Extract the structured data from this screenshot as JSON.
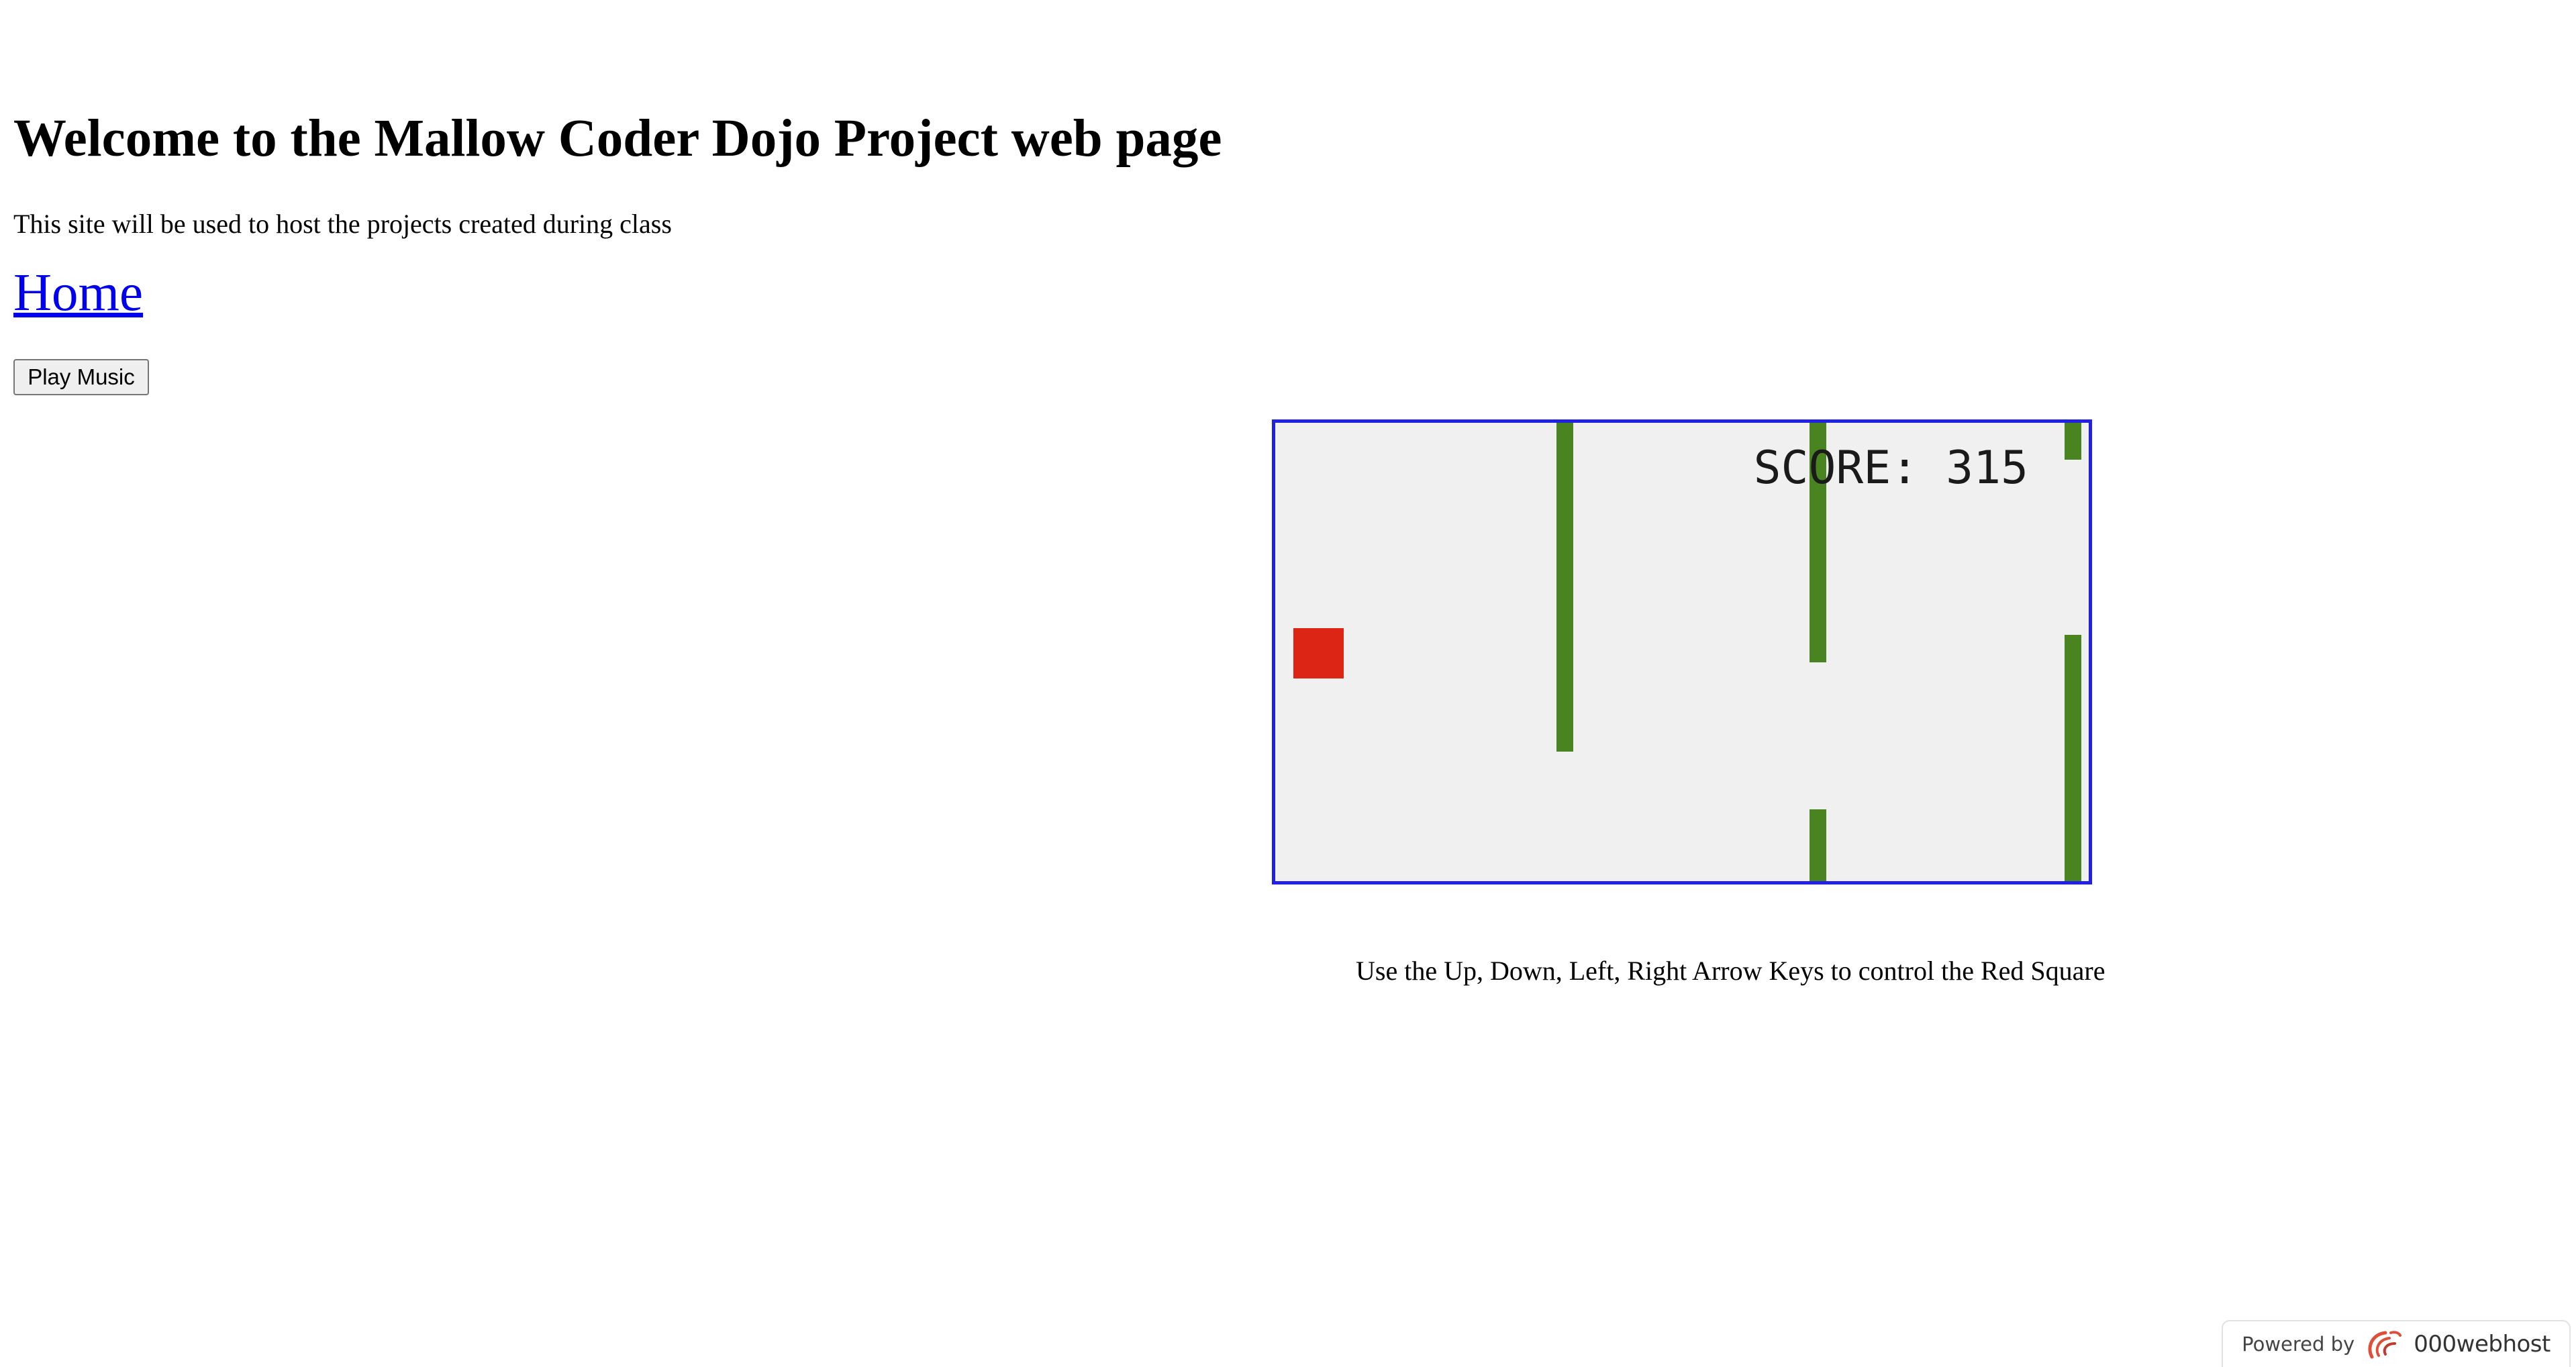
{
  "page": {
    "title": "Welcome to the Mallow Coder Dojo Project web page",
    "subtitle": "This site will be used to host the projects created during class",
    "home_link": "Home",
    "play_music_label": "Play Music"
  },
  "game": {
    "score_text": "SCORE: 315",
    "instructions": "Use the Up, Down, Left, Right Arrow Keys to control the Red Square",
    "colors": {
      "border": "#2121e5",
      "background": "#f0f0f0",
      "obstacle": "#4a8421",
      "player": "#dc2515"
    }
  },
  "badge": {
    "powered_by": "Powered by",
    "host_name": "000webhost",
    "logo_icon": "000webhost-swirl-logo-icon"
  }
}
